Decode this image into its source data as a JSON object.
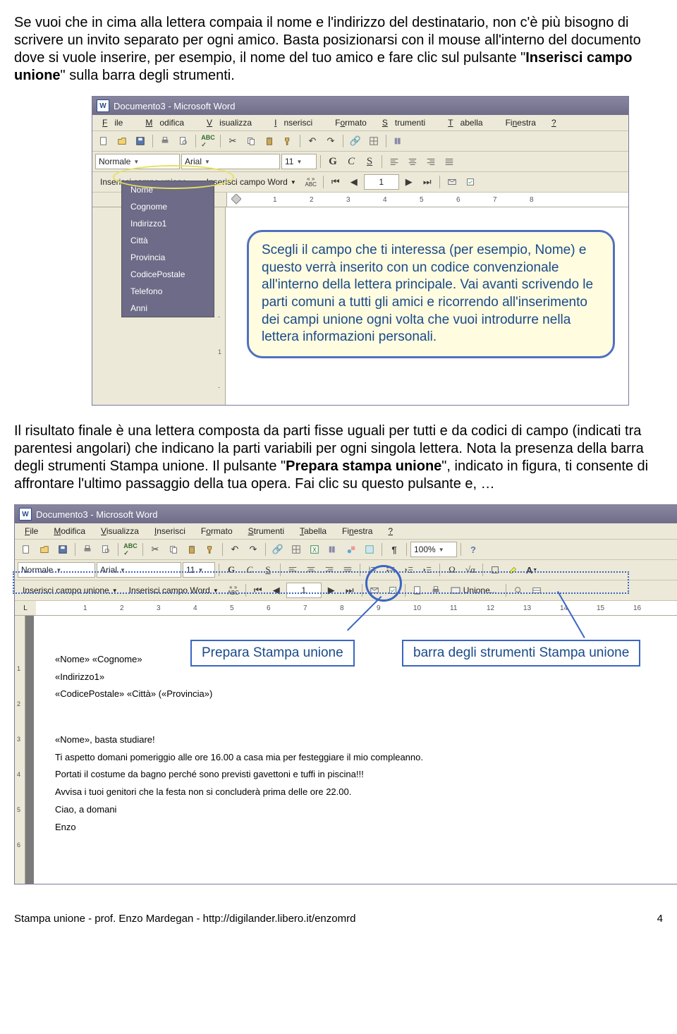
{
  "para1_a": "Se vuoi che in cima alla lettera compaia il nome e l'indirizzo del destinatario, non c'è più bisogno di scrivere un invito separato per ogni amico.",
  "para1_b_before": " Basta posizionarsi con il mouse all'interno del documento dove si vuole inserire, per esempio, il nome del tuo amico e fare clic sul pulsante \"",
  "para1_b_bold": "Inserisci campo unione",
  "para1_b_after": "\" sulla barra degli strumenti.",
  "word": {
    "title": "Documento3 - Microsoft Word",
    "menus": [
      {
        "u": "F",
        "rest": "ile"
      },
      {
        "u": "M",
        "rest": "odifica"
      },
      {
        "u": "V",
        "rest": "isualizza"
      },
      {
        "u": "I",
        "rest": "nserisci"
      },
      {
        "u": "",
        "rest": "Formato"
      },
      {
        "u": "S",
        "rest": "trumenti"
      },
      {
        "u": "T",
        "rest": "abella"
      },
      {
        "u": "",
        "rest": "Finestra"
      },
      {
        "u": "?",
        "rest": ""
      }
    ],
    "style_dd": "Normale",
    "font_dd": "Arial",
    "size_dd": "11",
    "bold": "G",
    "italic": "C",
    "under": "S",
    "merge_btn1": "Inserisci campo unione",
    "merge_btn2": "Inserisci campo Word",
    "abc_btn": "« »\nABC",
    "record_num": "1",
    "zoom": "100%",
    "unione_btn": "Unione..."
  },
  "ruler1": [
    "1",
    "2",
    "3",
    "4",
    "5",
    "6",
    "7",
    "8"
  ],
  "ruler2": [
    "1",
    "2",
    "3",
    "4",
    "5",
    "6",
    "7",
    "8",
    "9",
    "10",
    "11",
    "12",
    "13",
    "14",
    "15",
    "16"
  ],
  "fields": [
    "Nome",
    "Cognome",
    "Indirizzo1",
    "Città",
    "Provincia",
    "CodicePostale",
    "Telefono",
    "Anni"
  ],
  "callout1": "Scegli il campo che ti interessa (per esempio, Nome) e questo verrà inserito con un codice convenzionale all'interno della lettera principale. Vai avanti scrivendo le parti comuni a tutti gli amici e ricorrendo all'inserimento dei campi unione ogni volta che vuoi introdurre nella lettera informazioni personali.",
  "para2_a": "Il risultato finale è una lettera composta da parti fisse uguali per tutti e da codici di campo (indicati tra parentesi angolari) che indicano la parti variabili per ogni singola lettera. Nota la presenza della barra degli strumenti Stampa unione. Il pulsante \"",
  "para2_bold": "Prepara stampa unione",
  "para2_b": "\", indicato in figura, ti consente di affrontare l'ultimo passaggio della tua opera. Fai clic su questo pulsante e, …",
  "annot1": "Prepara Stampa unione",
  "annot2": "barra degli strumenti Stampa unione",
  "doc": {
    "l1": "«Nome» «Cognome»",
    "l2": "«Indirizzo1»",
    "l3": "«CodicePostale» «Città» («Provincia»)",
    "l4": "«Nome», basta studiare!",
    "l5": "Ti aspetto domani pomeriggio alle ore 16.00 a casa mia per festeggiare il mio compleanno.",
    "l6": "Portati il costume da bagno perché sono previsti gavettoni e tuffi in piscina!!!",
    "l7": "Avvisa i tuoi genitori che la festa non si concluderà prima delle ore 22.00.",
    "l8": "Ciao, a domani",
    "l9": "Enzo"
  },
  "footer_left": "Stampa unione -   prof. Enzo Mardegan   -   http://digilander.libero.it/enzomrd",
  "footer_right": "4"
}
